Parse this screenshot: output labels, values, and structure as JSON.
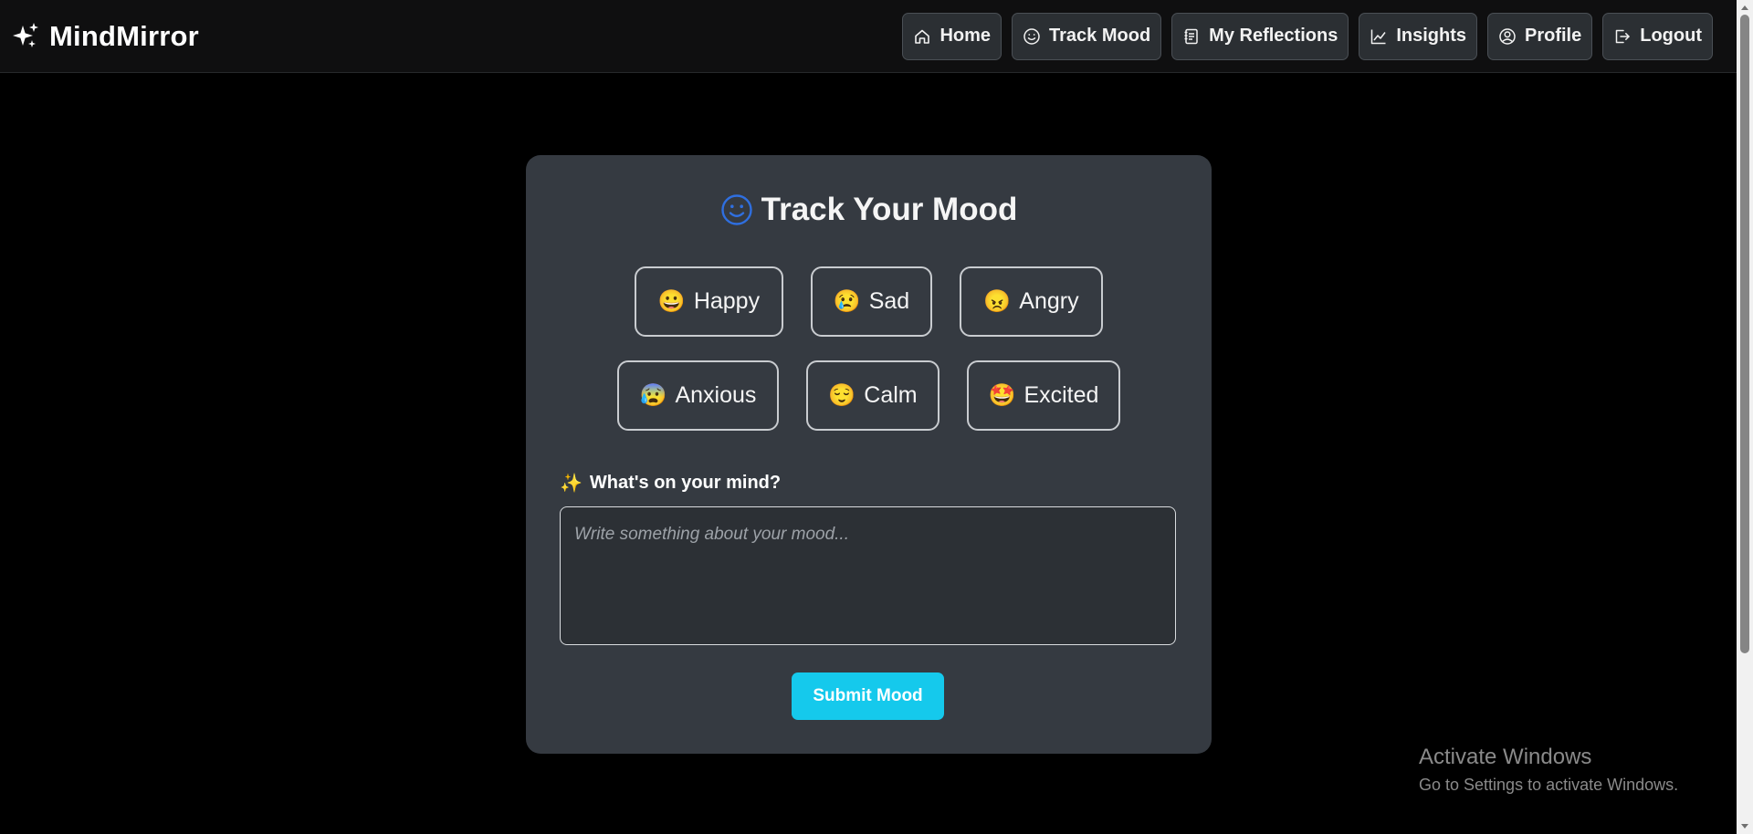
{
  "brand": {
    "name": "MindMirror",
    "icon": "sparkles-icon"
  },
  "nav": [
    {
      "label": "Home",
      "icon": "house-icon"
    },
    {
      "label": "Track Mood",
      "icon": "smiley-icon"
    },
    {
      "label": "My Reflections",
      "icon": "journal-icon"
    },
    {
      "label": "Insights",
      "icon": "graph-icon"
    },
    {
      "label": "Profile",
      "icon": "person-circle-icon"
    },
    {
      "label": "Logout",
      "icon": "logout-icon"
    }
  ],
  "card": {
    "title": "Track Your Mood",
    "title_icon": "smiley-icon",
    "moods": [
      {
        "emoji": "😀",
        "label": "Happy"
      },
      {
        "emoji": "😢",
        "label": "Sad"
      },
      {
        "emoji": "😠",
        "label": "Angry"
      },
      {
        "emoji": "😰",
        "label": "Anxious"
      },
      {
        "emoji": "😌",
        "label": "Calm"
      },
      {
        "emoji": "🤩",
        "label": "Excited"
      }
    ],
    "mind_label": "What's on your mind?",
    "mind_emoji": "✨",
    "mind_placeholder": "Write something about your mood...",
    "mind_value": "",
    "submit_label": "Submit Mood"
  },
  "watermark": {
    "title": "Activate Windows",
    "subtitle": "Go to Settings to activate Windows."
  },
  "colors": {
    "accent": "#15c9ec",
    "title_icon": "#2f6fe0",
    "card_bg": "#353a41",
    "page_bg": "#000000"
  }
}
